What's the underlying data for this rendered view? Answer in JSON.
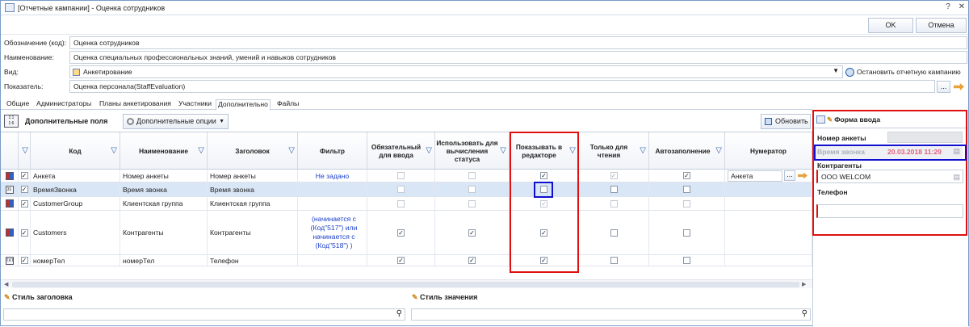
{
  "window": {
    "title": "[Отчетные кампании] - Оценка сотрудников",
    "help_label": "?",
    "close_label": "✕"
  },
  "buttons": {
    "ok": "OK",
    "cancel": "Отмена",
    "stop_campaign": "Остановить отчетную кампанию",
    "ellipsis": "..."
  },
  "fields": {
    "code_label": "Обозначение (код):",
    "code_value": "Оценка сотрудников",
    "name_label": "Наименование:",
    "name_value": "Оценка специальных профессиональных знаний, умений и навыков сотрудников",
    "type_label": "Вид:",
    "type_value": "Анкетирование",
    "indicator_label": "Показатель:",
    "indicator_value": "Оценка персонала(StaffEvaluation)"
  },
  "tabs": [
    "Общие",
    "Администраторы",
    "Планы анкетирования",
    "Участники",
    "Дополнительно",
    "Файлы"
  ],
  "active_tab": "Дополнительно",
  "toolbar": {
    "title": "Дополнительные поля",
    "options_label": "Дополнительные опции",
    "refresh_label": "Обновить"
  },
  "grid": {
    "columns": [
      "Код",
      "Наименование",
      "Заголовок",
      "Фильтр",
      "Обязательный для ввода",
      "Использовать для вычисления статуса",
      "Показывать в редакторе",
      "Только для чтения",
      "Автозаполнение",
      "Нумератор"
    ],
    "rows": [
      {
        "code": "Анкета",
        "name": "Номер анкеты",
        "header": "Номер анкеты",
        "filter": "Не задано",
        "required": false,
        "status": false,
        "show": true,
        "readonly": true,
        "autofill": true,
        "numerator": "Анкета",
        "icon": "book"
      },
      {
        "code": "ВремяЗвонка",
        "name": "Время звонка",
        "header": "Время звонка",
        "filter": "",
        "required": false,
        "status": false,
        "show": false,
        "readonly": false,
        "autofill": false,
        "numerator": "",
        "icon": "date"
      },
      {
        "code": "CustomerGroup",
        "name": "Клиентская группа",
        "header": "Клиентская группа",
        "filter": "",
        "required": false,
        "status": false,
        "show": true,
        "readonly": false,
        "autofill": false,
        "numerator": "",
        "icon": "book"
      },
      {
        "code": "Customers",
        "name": "Контрагенты",
        "header": "Контрагенты",
        "filter": "(начинается с (Код\"517\")    или начинается с (Код\"518\") )",
        "required": true,
        "status": true,
        "show": true,
        "readonly": false,
        "autofill": false,
        "numerator": "",
        "icon": "book"
      },
      {
        "code": "номерТел",
        "name": "номерТел",
        "header": "Телефон",
        "filter": "",
        "required": true,
        "status": true,
        "show": true,
        "readonly": false,
        "autofill": false,
        "numerator": "",
        "icon": "txt"
      }
    ]
  },
  "bottom": {
    "header_style": "Стиль заголовка",
    "value_style": "Стиль значения"
  },
  "form": {
    "title": "Форма ввода",
    "survey_number_label": "Номер анкеты",
    "call_time_label": "Время звонка",
    "call_time_value": "20.03.2018 11:29",
    "contractors_label": "Контрагенты",
    "contractors_value": "ООО WELCOM",
    "phone_label": "Телефон"
  },
  "colors": {
    "accent": "#2a5ea8",
    "highlight_red": "#e01010",
    "highlight_blue": "#1010d0",
    "selected_row": "#d9e6f6"
  }
}
